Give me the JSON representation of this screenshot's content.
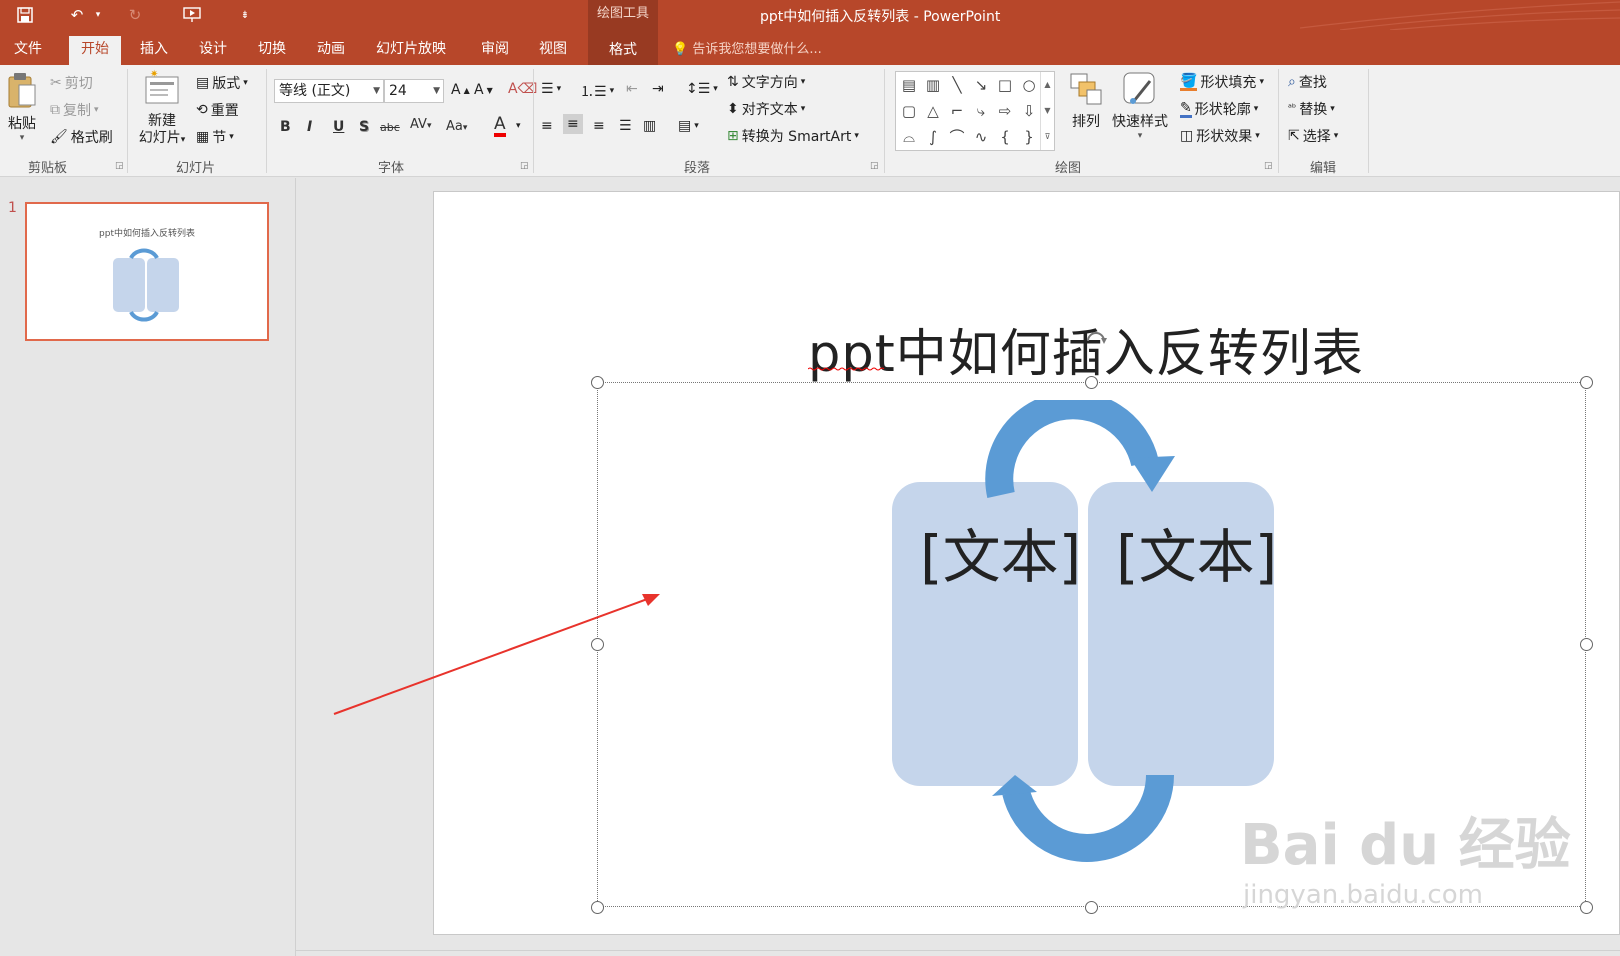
{
  "window": {
    "title": "ppt中如何插入反转列表 - PowerPoint",
    "context_tools_label": "绘图工具"
  },
  "tabs": [
    {
      "label": "文件"
    },
    {
      "label": "开始"
    },
    {
      "label": "插入"
    },
    {
      "label": "设计"
    },
    {
      "label": "切换"
    },
    {
      "label": "动画"
    },
    {
      "label": "幻灯片放映"
    },
    {
      "label": "审阅"
    },
    {
      "label": "视图"
    },
    {
      "label": "格式"
    }
  ],
  "tell_me": "告诉我您想要做什么...",
  "ribbon": {
    "clipboard": {
      "label": "剪贴板",
      "paste": "粘贴",
      "cut": "剪切",
      "copy": "复制",
      "format_painter": "格式刷"
    },
    "slides": {
      "label": "幻灯片",
      "new_slide_line1": "新建",
      "new_slide_line2": "幻灯片",
      "layout": "版式",
      "reset": "重置",
      "section": "节"
    },
    "font": {
      "label": "字体",
      "font_name": "等线 (正文)",
      "font_size": "24",
      "bold": "B",
      "italic": "I",
      "underline": "U",
      "shadow": "S",
      "strike": "abc",
      "spacing": "AV",
      "case": "Aa"
    },
    "paragraph": {
      "label": "段落",
      "text_direction": "文字方向",
      "align_text": "对齐文本",
      "smartart": "转换为 SmartArt"
    },
    "drawing": {
      "label": "绘图",
      "arrange": "排列",
      "quick_styles": "快速样式",
      "shape_fill": "形状填充",
      "shape_outline": "形状轮廓",
      "shape_effects": "形状效果"
    },
    "editing": {
      "label": "编辑",
      "find": "查找",
      "replace": "替换",
      "select": "选择"
    }
  },
  "thumbnails": [
    {
      "number": "1",
      "title": "ppt中如何插入反转列表"
    }
  ],
  "slide": {
    "title": "ppt中如何插入反转列表",
    "left_card_text": "[文本]",
    "right_card_text": "[文本]",
    "card_color": "#c5d5eb",
    "arrow_color": "#5b9bd5"
  },
  "watermark": {
    "brand": "Bai du 经验",
    "url": "jingyan.baidu.com"
  },
  "colors": {
    "accent": "#b7472a",
    "context_tab": "#983a22",
    "selection_thumb": "#e1694b",
    "annotation_arrow": "#e8332c"
  }
}
